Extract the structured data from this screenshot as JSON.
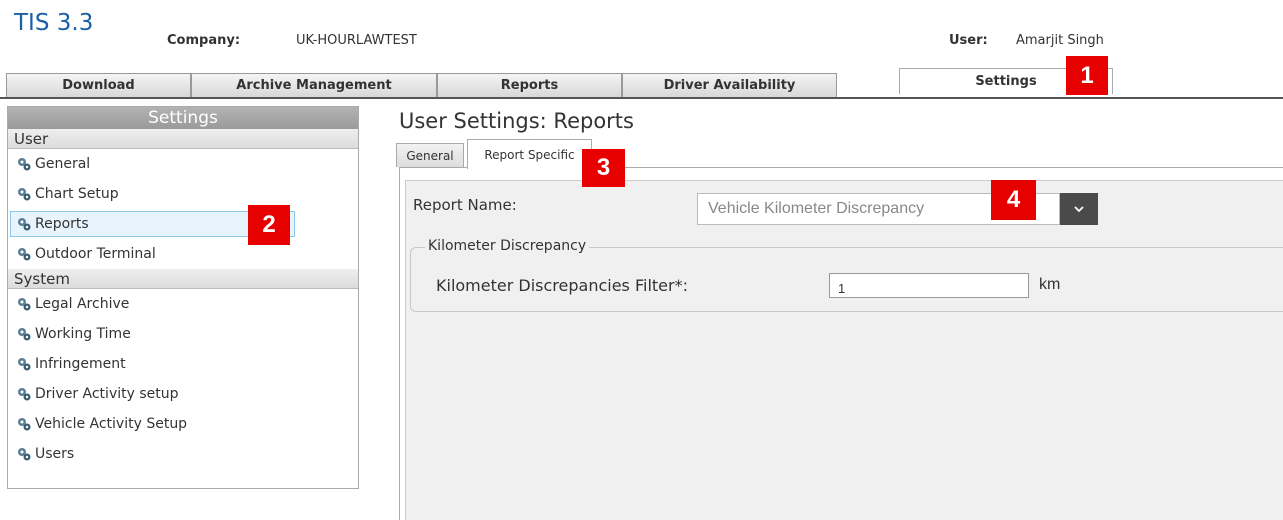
{
  "header": {
    "app_title": "TIS 3.3",
    "company_label": "Company:",
    "company_value": "UK-HOURLAWTEST",
    "user_label": "User:",
    "user_value": "Amarjit Singh"
  },
  "main_tabs": [
    {
      "label": "Download"
    },
    {
      "label": "Archive Management"
    },
    {
      "label": "Reports"
    },
    {
      "label": "Driver Availability"
    },
    {
      "label": "Settings",
      "active": true
    }
  ],
  "markers": [
    "1",
    "2",
    "3",
    "4"
  ],
  "sidebar": {
    "title": "Settings",
    "user_section": "User",
    "user_items": [
      {
        "label": "General"
      },
      {
        "label": "Chart Setup"
      },
      {
        "label": "Reports",
        "selected": true
      },
      {
        "label": "Outdoor Terminal"
      }
    ],
    "system_section": "System",
    "system_items": [
      {
        "label": "Legal Archive"
      },
      {
        "label": "Working Time"
      },
      {
        "label": "Infringement"
      },
      {
        "label": "Driver Activity setup"
      },
      {
        "label": "Vehicle Activity Setup"
      },
      {
        "label": "Users"
      }
    ]
  },
  "main": {
    "page_title": "User Settings: Reports",
    "sub_tabs": [
      {
        "label": "General"
      },
      {
        "label": "Report Specific",
        "active": true
      }
    ],
    "report_name_label": "Report Name:",
    "report_name_value": "Vehicle Kilometer Discrepancy",
    "fieldset_legend": "Kilometer Discrepancy",
    "filter_label": "Kilometer Discrepancies Filter*:",
    "filter_value": "1",
    "filter_unit": "km"
  },
  "colors": {
    "title_blue": "#1a5fa8",
    "marker_red": "#e60000",
    "selected_bg": "#e7f4fd"
  },
  "icons": {
    "nav_item": "gear-icon",
    "dropdown": "chevron-down-icon"
  }
}
